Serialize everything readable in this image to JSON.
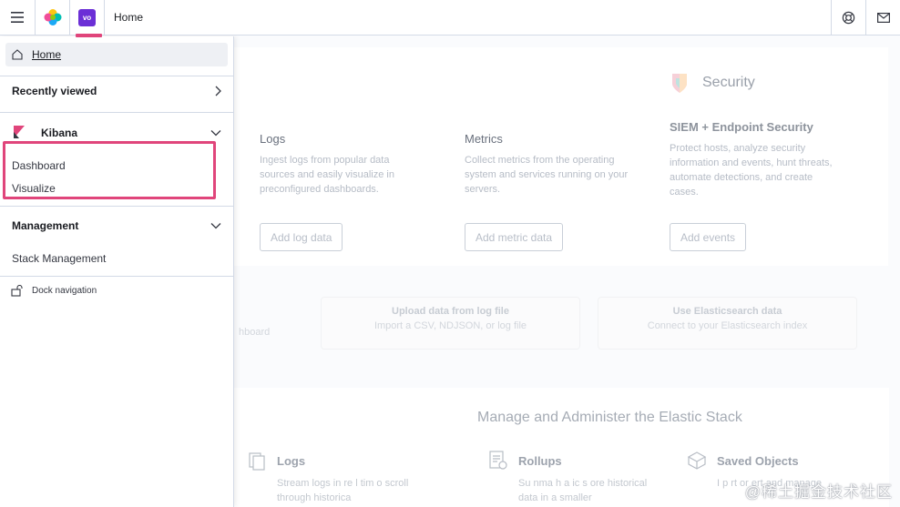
{
  "header": {
    "menu_icon": "hamburger-icon",
    "logo_icon": "elastic-logo-icon",
    "space_badge": "vo",
    "breadcrumb": "Home",
    "help_icon": "help-lifebuoy-icon",
    "newsfeed_icon": "mail-icon",
    "accent_color": "#e0457b",
    "space_color": "#6b2fd6"
  },
  "nav": {
    "home_label": "Home",
    "recently_viewed": "Recently viewed",
    "kibana": "Kibana",
    "dashboard": "Dashboard",
    "visualize": "Visualize",
    "management": "Management",
    "stack_management": "Stack Management",
    "dock_navigation": "Dock navigation"
  },
  "background": {
    "security_title": "Security",
    "logs": {
      "title": "Logs",
      "desc": "Ingest logs from popular data sources and easily visualize in preconfigured dashboards.",
      "button": "Add log data"
    },
    "metrics": {
      "title": "Metrics",
      "desc": "Collect metrics from the operating system and services running on your servers.",
      "button": "Add metric data"
    },
    "siem": {
      "title": "SIEM + Endpoint Security",
      "desc": "Protect hosts, analyze security information and events, hunt threats, automate detections, and create cases.",
      "button": "Add events"
    },
    "sample_partial": "hboard",
    "upload": {
      "title": "Upload data from log file",
      "desc": "Import a CSV, NDJSON, or log file"
    },
    "es_data": {
      "title": "Use Elasticsearch data",
      "desc": "Connect to your Elasticsearch index"
    },
    "manage_title": "Manage and Administer the Elastic Stack",
    "manage_logs": {
      "title": "Logs",
      "desc": "Stream logs in re l tim o scroll through historica"
    },
    "rollups": {
      "title": "Rollups",
      "desc": "Su nma h a ic s ore historical data in a smaller"
    },
    "saved_objects": {
      "title": "Saved Objects",
      "desc": "I p rt or ert and manage"
    }
  },
  "watermark": "@稀土掘金技术社区"
}
